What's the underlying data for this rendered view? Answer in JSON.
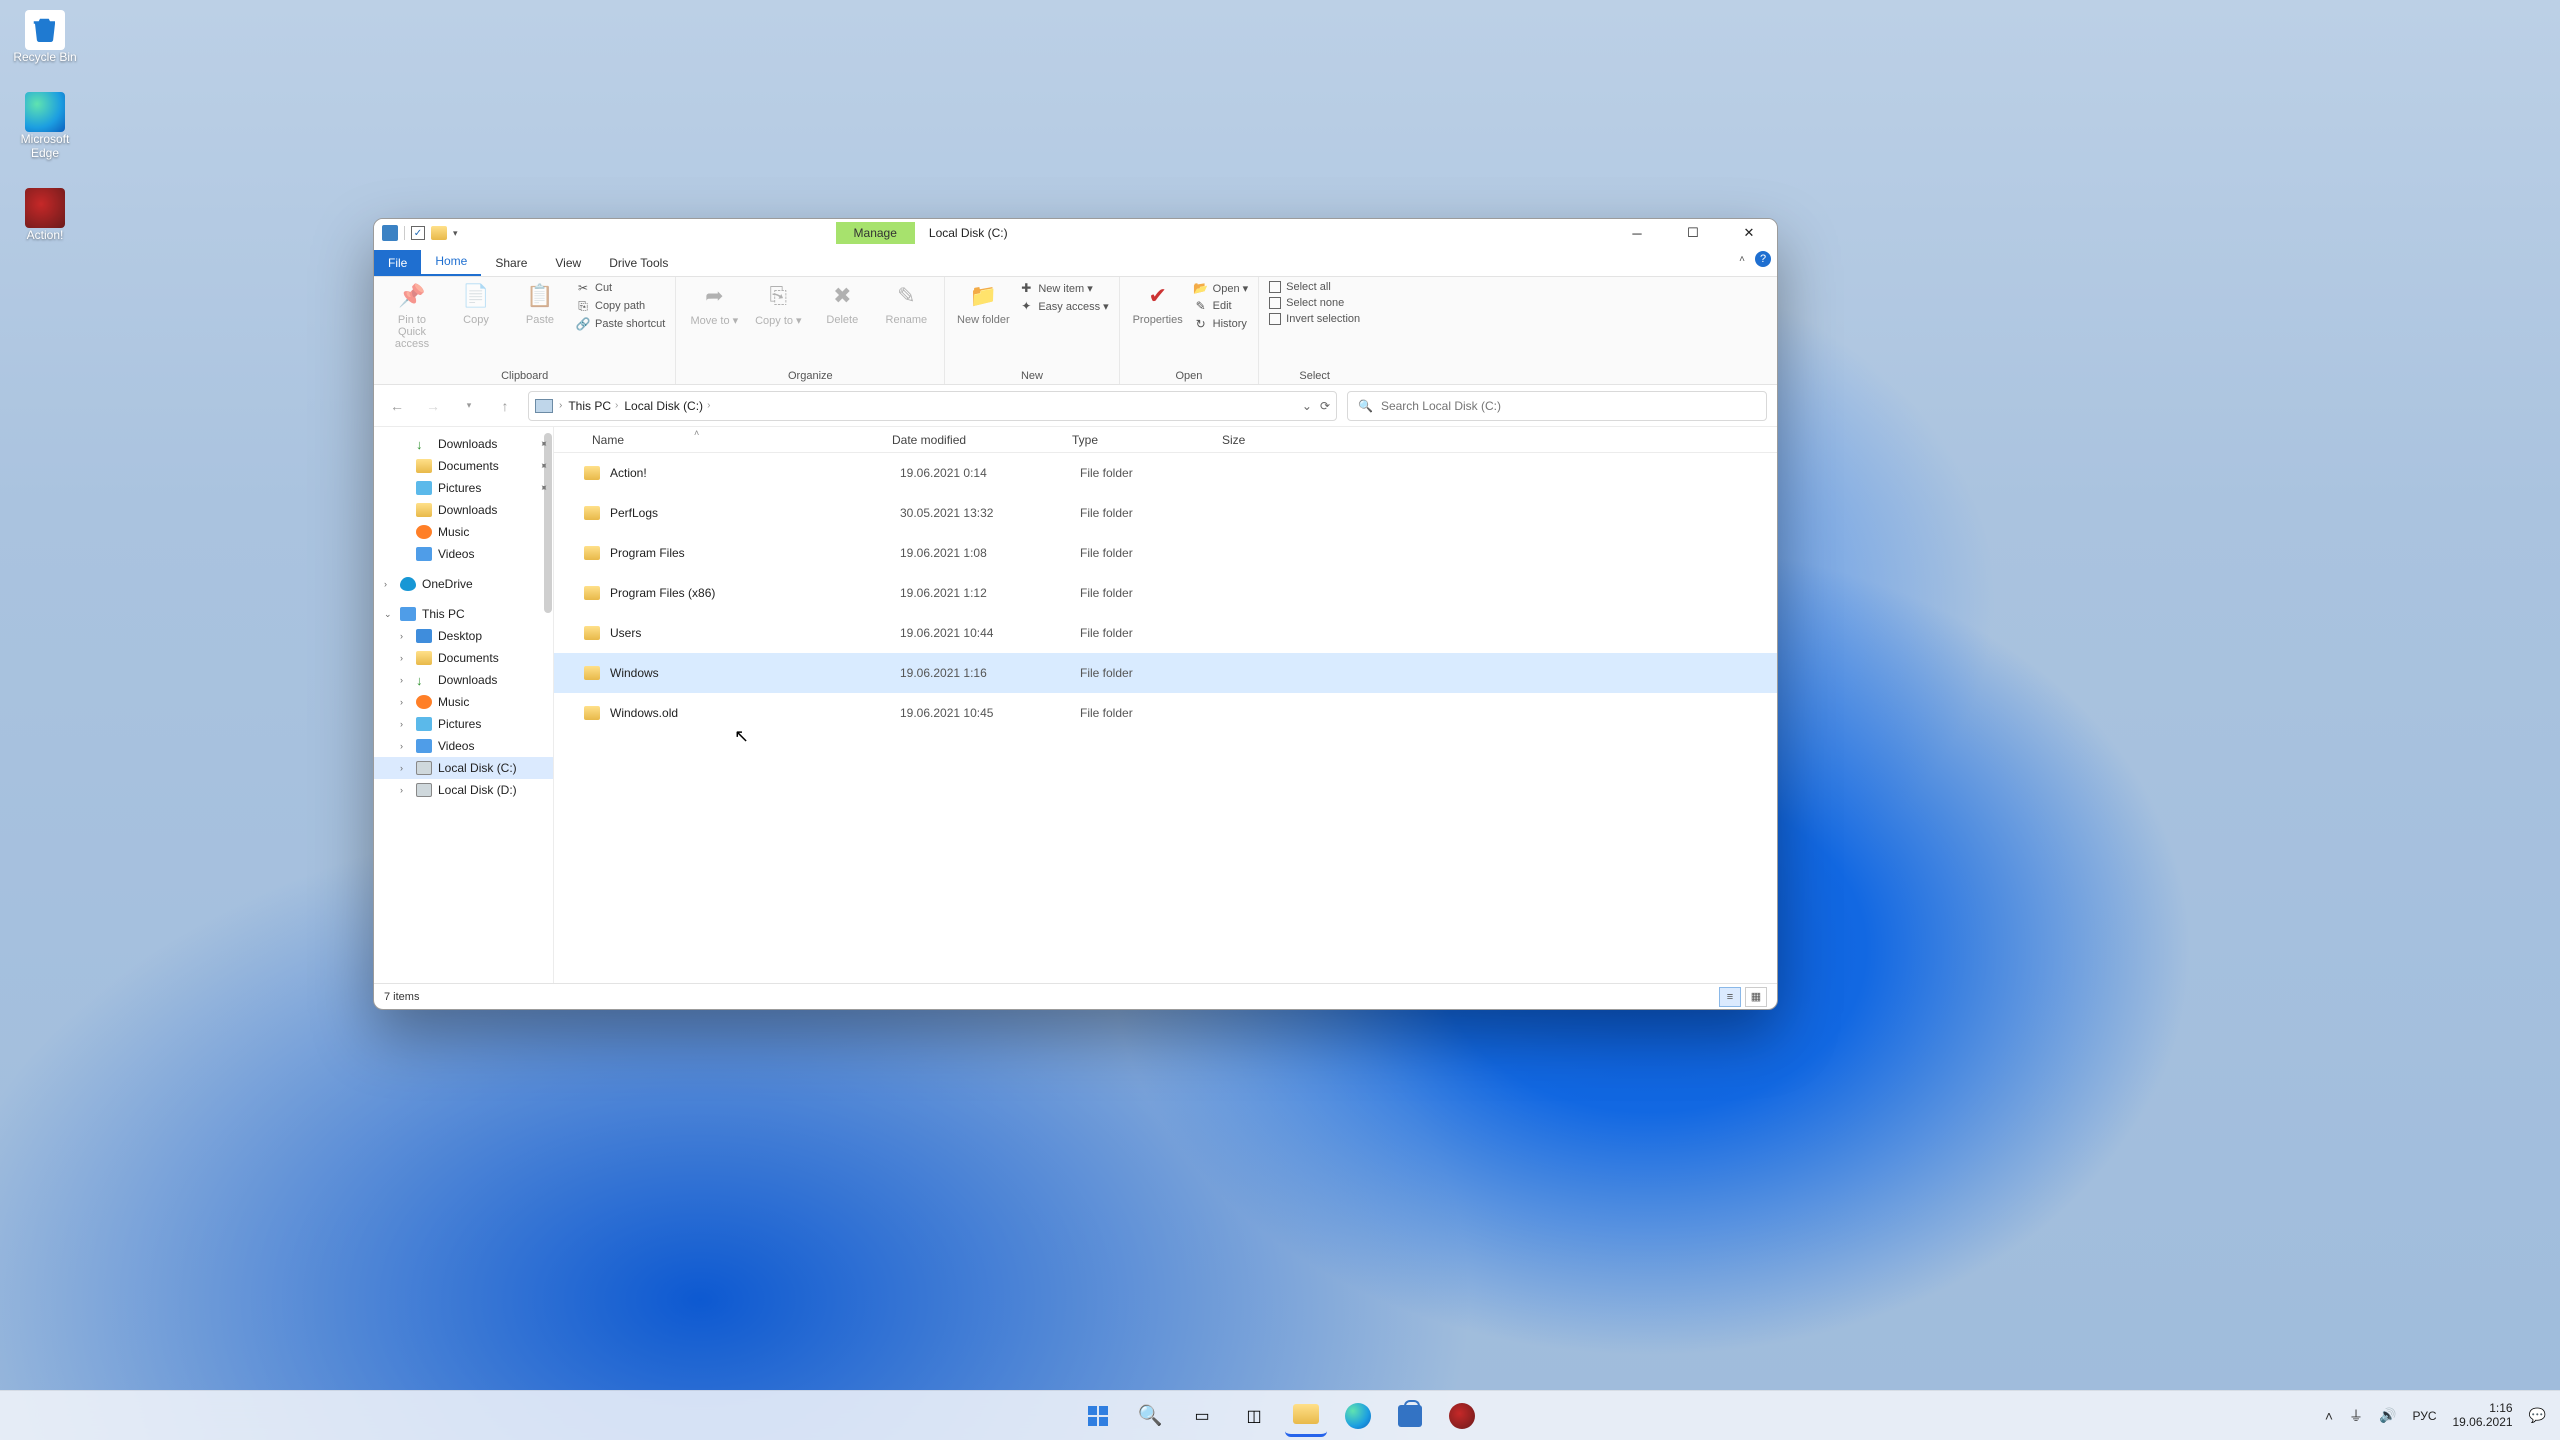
{
  "desktop_icons": {
    "recycle": "Recycle Bin",
    "edge": "Microsoft Edge",
    "action": "Action!"
  },
  "window": {
    "manage_tab": "Manage",
    "title": "Local Disk (C:)",
    "tabs": {
      "file": "File",
      "home": "Home",
      "share": "Share",
      "view": "View",
      "drivetools": "Drive Tools"
    }
  },
  "ribbon": {
    "clipboard": {
      "label": "Clipboard",
      "pin": "Pin to Quick access",
      "copy": "Copy",
      "paste": "Paste",
      "cut": "Cut",
      "copypath": "Copy path",
      "pasteshortcut": "Paste shortcut"
    },
    "organize": {
      "label": "Organize",
      "moveto": "Move to ▾",
      "copyto": "Copy to ▾",
      "delete": "Delete",
      "rename": "Rename"
    },
    "new": {
      "label": "New",
      "newfolder": "New folder",
      "newitem": "New item ▾",
      "easyaccess": "Easy access ▾"
    },
    "open": {
      "label": "Open",
      "properties": "Properties",
      "open": "Open ▾",
      "edit": "Edit",
      "history": "History"
    },
    "select": {
      "label": "Select",
      "selectall": "Select all",
      "selectnone": "Select none",
      "invert": "Invert selection"
    }
  },
  "address": {
    "thispc": "This PC",
    "location": "Local Disk (C:)"
  },
  "search": {
    "placeholder": "Search Local Disk (C:)"
  },
  "sidebar": [
    {
      "label": "Downloads",
      "icon": "dl",
      "pinned": true
    },
    {
      "label": "Documents",
      "icon": "folder",
      "pinned": true
    },
    {
      "label": "Pictures",
      "icon": "pic",
      "pinned": true
    },
    {
      "label": "Downloads",
      "icon": "folder"
    },
    {
      "label": "Music",
      "icon": "music"
    },
    {
      "label": "Videos",
      "icon": "video"
    }
  ],
  "sidebar_onedrive": "OneDrive",
  "sidebar_thispc": "This PC",
  "sidebar_pc_children": [
    {
      "label": "Desktop",
      "icon": "desktop"
    },
    {
      "label": "Documents",
      "icon": "folder"
    },
    {
      "label": "Downloads",
      "icon": "dl"
    },
    {
      "label": "Music",
      "icon": "music"
    },
    {
      "label": "Pictures",
      "icon": "pic"
    },
    {
      "label": "Videos",
      "icon": "video"
    },
    {
      "label": "Local Disk (C:)",
      "icon": "drive",
      "selected": true
    },
    {
      "label": "Local Disk (D:)",
      "icon": "drive"
    }
  ],
  "columns": {
    "name": "Name",
    "date": "Date modified",
    "type": "Type",
    "size": "Size"
  },
  "files": [
    {
      "name": "Action!",
      "date": "19.06.2021 0:14",
      "type": "File folder"
    },
    {
      "name": "PerfLogs",
      "date": "30.05.2021 13:32",
      "type": "File folder"
    },
    {
      "name": "Program Files",
      "date": "19.06.2021 1:08",
      "type": "File folder"
    },
    {
      "name": "Program Files (x86)",
      "date": "19.06.2021 1:12",
      "type": "File folder"
    },
    {
      "name": "Users",
      "date": "19.06.2021 10:44",
      "type": "File folder"
    },
    {
      "name": "Windows",
      "date": "19.06.2021 1:16",
      "type": "File folder",
      "hover": true
    },
    {
      "name": "Windows.old",
      "date": "19.06.2021 10:45",
      "type": "File folder"
    }
  ],
  "status": {
    "count": "7 items"
  },
  "tray": {
    "lang": "РУС",
    "time": "1:16",
    "date": "19.06.2021"
  }
}
